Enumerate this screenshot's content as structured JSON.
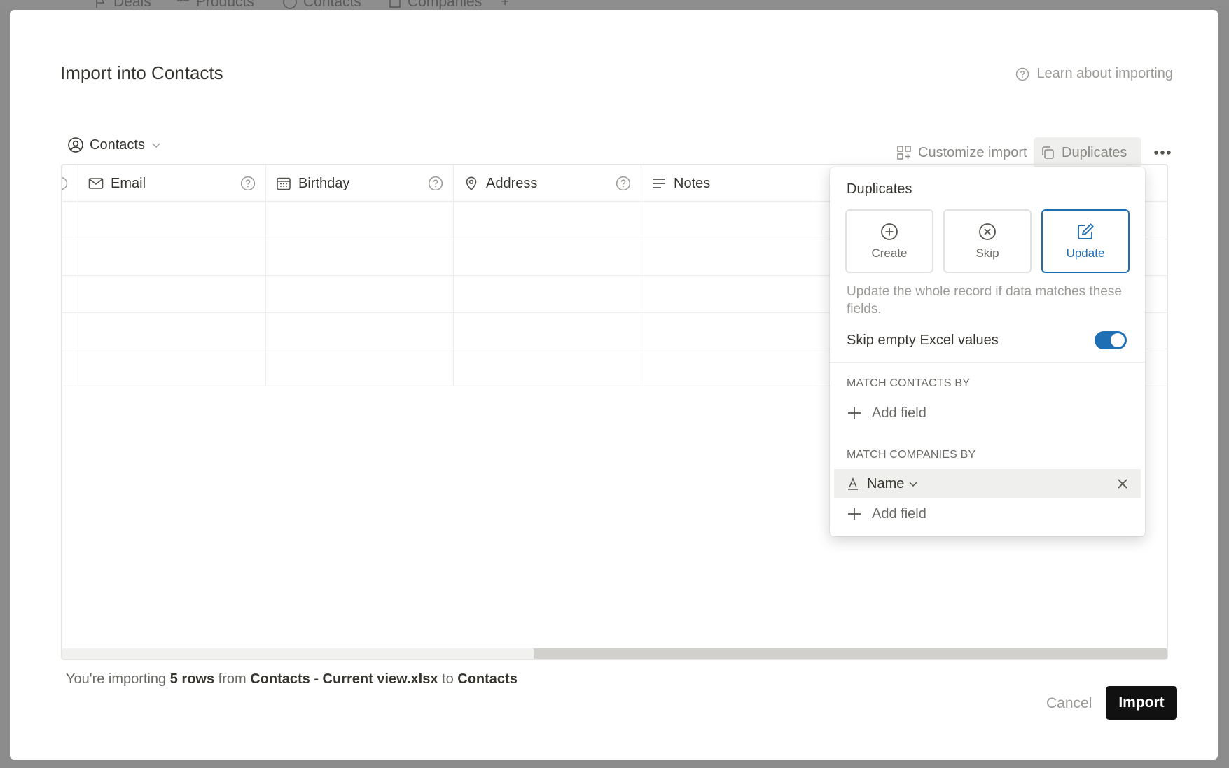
{
  "background": {
    "tabs": [
      {
        "label": "Deals",
        "icon": "flag-icon"
      },
      {
        "label": "Products",
        "icon": "grid-icon"
      },
      {
        "label": "Contacts",
        "icon": "person-circle-icon"
      },
      {
        "label": "Companies",
        "icon": "building-icon"
      }
    ]
  },
  "modal": {
    "title": "Import into Contacts",
    "learn_link": "Learn about importing"
  },
  "toolbar": {
    "database_label": "Contacts",
    "customize_label": "Customize import",
    "duplicates_label": "Duplicates"
  },
  "table": {
    "columns": [
      {
        "label": "Email",
        "icon": "mail-icon"
      },
      {
        "label": "Birthday",
        "icon": "calendar-icon"
      },
      {
        "label": "Address",
        "icon": "location-pin-icon"
      },
      {
        "label": "Notes",
        "icon": "text-lines-icon"
      }
    ],
    "row_count": 5
  },
  "footer": {
    "prefix": "You're importing",
    "rows": "5 rows",
    "from_word": "from",
    "file": "Contacts - Current view.xlsx",
    "to_word": "to",
    "destination": "Contacts",
    "cancel_label": "Cancel",
    "import_label": "Import"
  },
  "duplicates_popover": {
    "title": "Duplicates",
    "options": [
      {
        "label": "Create",
        "icon": "plus-circle-icon",
        "selected": false
      },
      {
        "label": "Skip",
        "icon": "x-circle-icon",
        "selected": false
      },
      {
        "label": "Update",
        "icon": "edit-icon",
        "selected": true
      }
    ],
    "description": "Update the whole record if data matches these fields.",
    "skip_empty_label": "Skip empty Excel values",
    "skip_empty_enabled": true,
    "match_contacts_label": "MATCH CONTACTS BY",
    "match_companies_label": "MATCH COMPANIES BY",
    "add_field_label": "Add field",
    "company_match_field": "Name",
    "accent_color": "#1f6fb5"
  }
}
